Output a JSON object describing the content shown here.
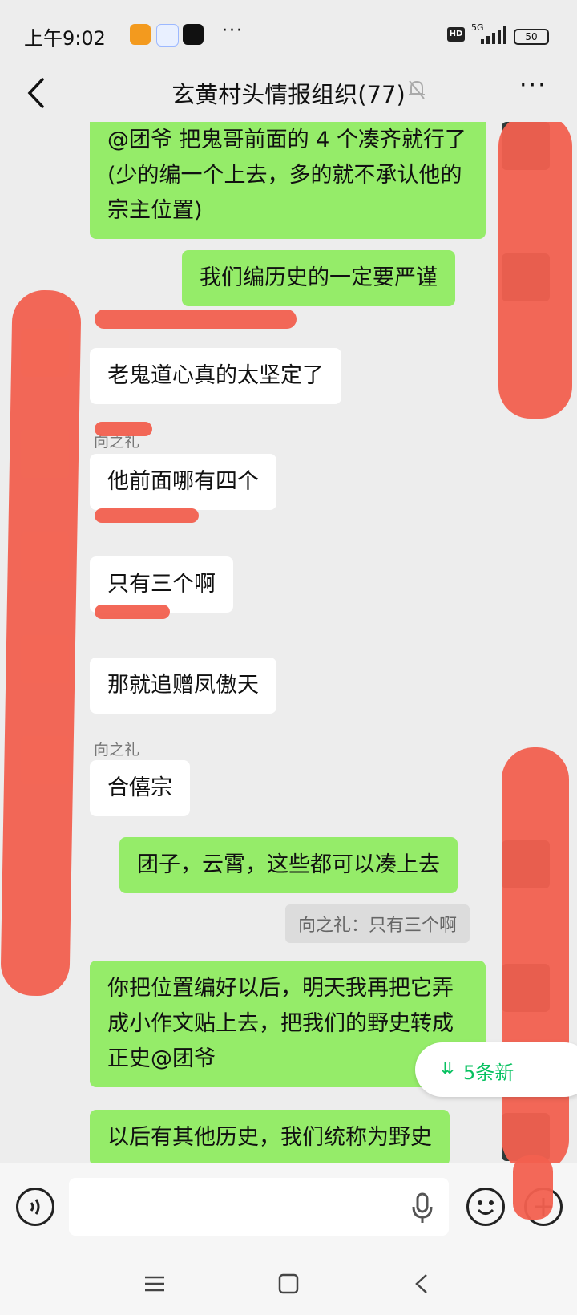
{
  "status_bar": {
    "time": "上午9:02",
    "more": "···",
    "hd": "HD",
    "network": "5G",
    "battery": "50"
  },
  "header": {
    "back_icon": "chevron-left-icon",
    "title": "玄黄村头情报组织(77)",
    "mute_icon": "bell-muted-icon",
    "menu": "···"
  },
  "messages": [
    {
      "dir": "out",
      "text": "@团爷  把鬼哥前面的 4 个凑齐就行了(少的编一个上去，多的就不承认他的宗主位置)"
    },
    {
      "dir": "out",
      "text": "我们编历史的一定要严谨"
    },
    {
      "dir": "in",
      "sender": "",
      "text": "老鬼道心真的太坚定了"
    },
    {
      "dir": "in",
      "sender": "向之礼",
      "text": "他前面哪有四个"
    },
    {
      "dir": "in",
      "sender": "",
      "text": "只有三个啊"
    },
    {
      "dir": "in",
      "sender": "",
      "text": "那就追赠凤傲天"
    },
    {
      "dir": "in",
      "sender": "向之礼",
      "text": "合僖宗"
    },
    {
      "dir": "out",
      "text": "团子，云霄，这些都可以凑上去"
    },
    {
      "dir": "quote",
      "text": "向之礼：只有三个啊"
    },
    {
      "dir": "out",
      "text": "你把位置编好以后，明天我再把它弄成小作文贴上去，把我们的野史转成正史@团爷"
    },
    {
      "dir": "out",
      "text": "以后有其他历史，我们统称为野史"
    }
  ],
  "new_messages": {
    "icon": "double-chevron-down-icon",
    "label": "5条新"
  },
  "input_bar": {
    "voice_icon": "voice-icon",
    "mic_icon": "microphone-icon",
    "emoji_icon": "emoji-icon",
    "plus_icon": "plus-icon"
  },
  "nav_bar": {
    "menu_icon": "menu-icon",
    "home_icon": "home-icon",
    "back_icon": "back-icon"
  },
  "colors": {
    "outgoing_bubble": "#95ec69",
    "incoming_bubble": "#ffffff",
    "background": "#ededed",
    "accent": "#07c160",
    "redaction": "#f2604f"
  }
}
